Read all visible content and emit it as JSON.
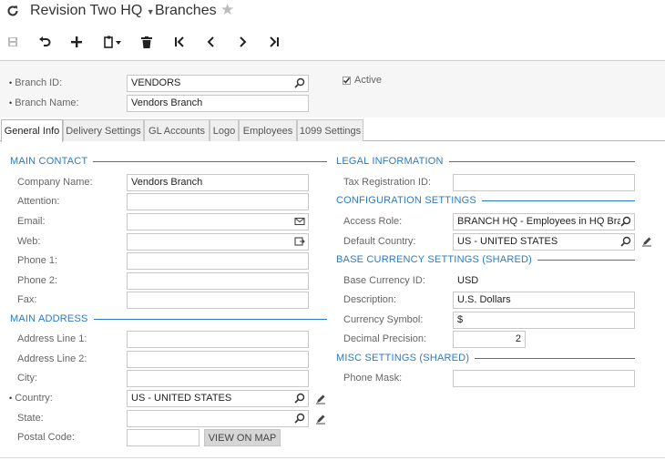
{
  "title": {
    "company": "Revision Two HQ",
    "screen": "Branches"
  },
  "header": {
    "branch_id_label": "Branch ID:",
    "branch_id_value": "VENDORS",
    "branch_name_label": "Branch Name:",
    "branch_name_value": "Vendors Branch",
    "active_label": "Active",
    "active_checked": true
  },
  "tabs": [
    {
      "label": "General Info",
      "active": true
    },
    {
      "label": "Delivery Settings"
    },
    {
      "label": "GL Accounts"
    },
    {
      "label": "Logo"
    },
    {
      "label": "Employees"
    },
    {
      "label": "1099 Settings"
    }
  ],
  "main_contact": {
    "heading": "MAIN CONTACT",
    "company_name_label": "Company Name:",
    "company_name_value": "Vendors Branch",
    "attention_label": "Attention:",
    "email_label": "Email:",
    "web_label": "Web:",
    "phone1_label": "Phone 1:",
    "phone2_label": "Phone 2:",
    "fax_label": "Fax:"
  },
  "main_address": {
    "heading": "MAIN ADDRESS",
    "address1_label": "Address Line 1:",
    "address2_label": "Address Line 2:",
    "city_label": "City:",
    "country_label": "Country:",
    "country_value": "US - UNITED STATES",
    "state_label": "State:",
    "postal_label": "Postal Code:",
    "view_on_map": "VIEW ON MAP"
  },
  "legal": {
    "heading": "LEGAL INFORMATION",
    "tax_label": "Tax Registration ID:"
  },
  "config": {
    "heading": "CONFIGURATION SETTINGS",
    "access_role_label": "Access Role:",
    "access_role_value": "BRANCH HQ - Employees in HQ Bra",
    "default_country_label": "Default Country:",
    "default_country_value": "US - UNITED STATES"
  },
  "currency": {
    "heading": "BASE CURRENCY SETTINGS (SHARED)",
    "base_label": "Base Currency ID:",
    "base_value": "USD",
    "desc_label": "Description:",
    "desc_value": "U.S. Dollars",
    "symbol_label": "Currency Symbol:",
    "symbol_value": "$",
    "precision_label": "Decimal Precision:",
    "precision_value": "2"
  },
  "misc": {
    "heading": "MISC SETTINGS (SHARED)",
    "phone_mask_label": "Phone Mask:"
  },
  "colors": {
    "accent": "#2c7bbf"
  },
  "icons": [
    "refresh-icon",
    "save-icon",
    "undo-icon",
    "add-icon",
    "copy-paste-icon",
    "delete-icon",
    "first-icon",
    "prev-icon",
    "next-icon",
    "last-icon",
    "star-icon",
    "search-icon",
    "mail-icon",
    "link-icon",
    "edit-icon"
  ]
}
